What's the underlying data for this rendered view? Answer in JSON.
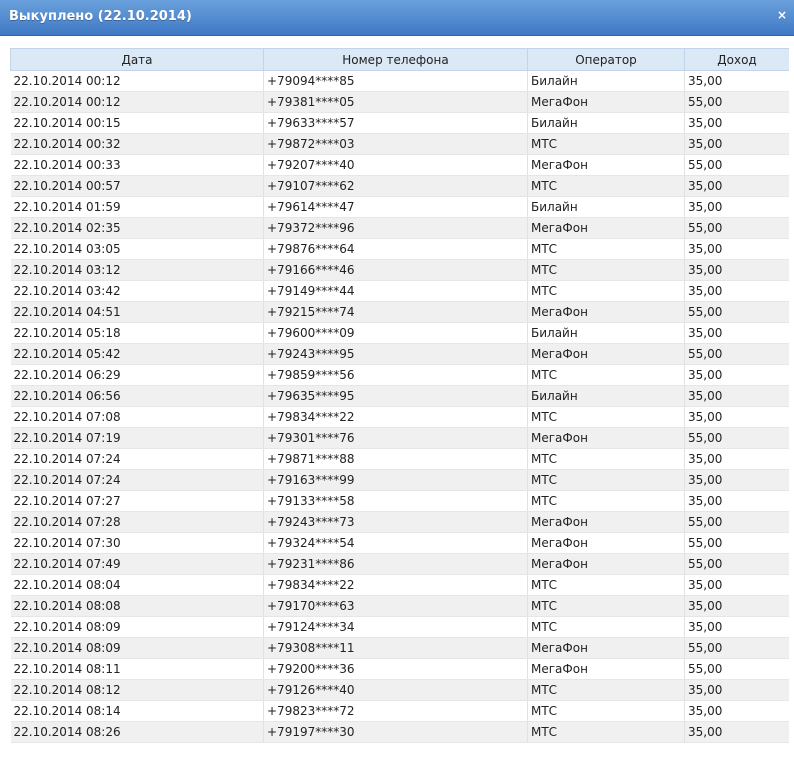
{
  "window": {
    "title": "Выкуплено (22.10.2014)",
    "close_icon": "close-icon",
    "close_glyph": "×"
  },
  "table": {
    "columns": [
      "Дата",
      "Номер телефона",
      "Оператор",
      "Доход"
    ],
    "rows": [
      [
        "22.10.2014 00:12",
        "+79094****85",
        "Билайн",
        "35,00"
      ],
      [
        "22.10.2014 00:12",
        "+79381****05",
        "МегаФон",
        "55,00"
      ],
      [
        "22.10.2014 00:15",
        "+79633****57",
        "Билайн",
        "35,00"
      ],
      [
        "22.10.2014 00:32",
        "+79872****03",
        "МТС",
        "35,00"
      ],
      [
        "22.10.2014 00:33",
        "+79207****40",
        "МегаФон",
        "55,00"
      ],
      [
        "22.10.2014 00:57",
        "+79107****62",
        "МТС",
        "35,00"
      ],
      [
        "22.10.2014 01:59",
        "+79614****47",
        "Билайн",
        "35,00"
      ],
      [
        "22.10.2014 02:35",
        "+79372****96",
        "МегаФон",
        "55,00"
      ],
      [
        "22.10.2014 03:05",
        "+79876****64",
        "МТС",
        "35,00"
      ],
      [
        "22.10.2014 03:12",
        "+79166****46",
        "МТС",
        "35,00"
      ],
      [
        "22.10.2014 03:42",
        "+79149****44",
        "МТС",
        "35,00"
      ],
      [
        "22.10.2014 04:51",
        "+79215****74",
        "МегаФон",
        "55,00"
      ],
      [
        "22.10.2014 05:18",
        "+79600****09",
        "Билайн",
        "35,00"
      ],
      [
        "22.10.2014 05:42",
        "+79243****95",
        "МегаФон",
        "55,00"
      ],
      [
        "22.10.2014 06:29",
        "+79859****56",
        "МТС",
        "35,00"
      ],
      [
        "22.10.2014 06:56",
        "+79635****95",
        "Билайн",
        "35,00"
      ],
      [
        "22.10.2014 07:08",
        "+79834****22",
        "МТС",
        "35,00"
      ],
      [
        "22.10.2014 07:19",
        "+79301****76",
        "МегаФон",
        "55,00"
      ],
      [
        "22.10.2014 07:24",
        "+79871****88",
        "МТС",
        "35,00"
      ],
      [
        "22.10.2014 07:24",
        "+79163****99",
        "МТС",
        "35,00"
      ],
      [
        "22.10.2014 07:27",
        "+79133****58",
        "МТС",
        "35,00"
      ],
      [
        "22.10.2014 07:28",
        "+79243****73",
        "МегаФон",
        "55,00"
      ],
      [
        "22.10.2014 07:30",
        "+79324****54",
        "МегаФон",
        "55,00"
      ],
      [
        "22.10.2014 07:49",
        "+79231****86",
        "МегаФон",
        "55,00"
      ],
      [
        "22.10.2014 08:04",
        "+79834****22",
        "МТС",
        "35,00"
      ],
      [
        "22.10.2014 08:08",
        "+79170****63",
        "МТС",
        "35,00"
      ],
      [
        "22.10.2014 08:09",
        "+79124****34",
        "МТС",
        "35,00"
      ],
      [
        "22.10.2014 08:09",
        "+79308****11",
        "МегаФон",
        "55,00"
      ],
      [
        "22.10.2014 08:11",
        "+79200****36",
        "МегаФон",
        "55,00"
      ],
      [
        "22.10.2014 08:12",
        "+79126****40",
        "МТС",
        "35,00"
      ],
      [
        "22.10.2014 08:14",
        "+79823****72",
        "МТС",
        "35,00"
      ],
      [
        "22.10.2014 08:26",
        "+79197****30",
        "МТС",
        "35,00"
      ]
    ]
  },
  "colors": {
    "titlebar": "#4a86cf",
    "header_bg": "#dbe8f6",
    "row_alt": "#f0f0f0"
  }
}
